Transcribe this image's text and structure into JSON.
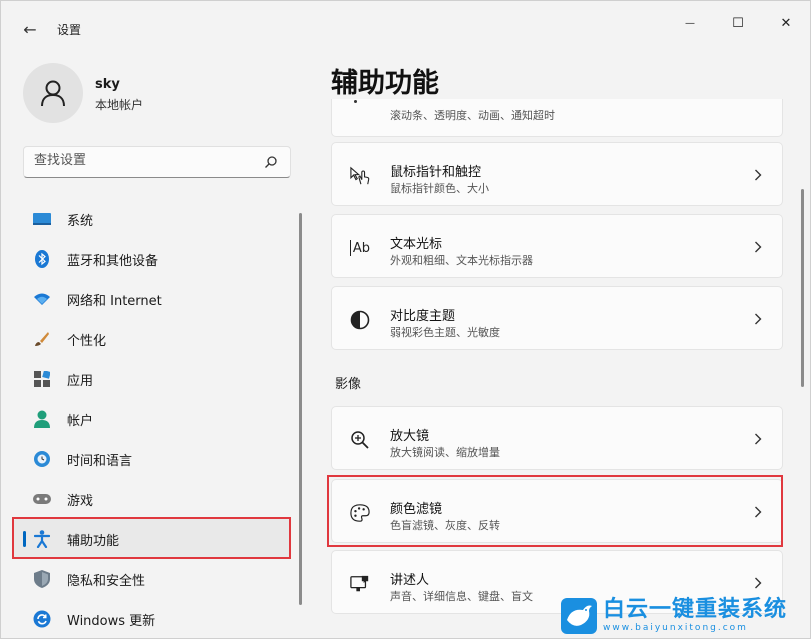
{
  "window": {
    "title": "设置",
    "back_glyph": "←",
    "minimize_glyph": "—",
    "maximize_glyph": "☐",
    "close_glyph": "✕"
  },
  "user": {
    "name": "sky",
    "account_type": "本地帐户"
  },
  "search": {
    "placeholder": "查找设置"
  },
  "nav": {
    "items": [
      {
        "label": "系统",
        "icon": "monitor-icon"
      },
      {
        "label": "蓝牙和其他设备",
        "icon": "bluetooth-icon"
      },
      {
        "label": "网络和 Internet",
        "icon": "wifi-icon"
      },
      {
        "label": "个性化",
        "icon": "brush-icon"
      },
      {
        "label": "应用",
        "icon": "apps-icon"
      },
      {
        "label": "帐户",
        "icon": "account-icon"
      },
      {
        "label": "时间和语言",
        "icon": "globe-clock-icon"
      },
      {
        "label": "游戏",
        "icon": "gamepad-icon"
      },
      {
        "label": "辅助功能",
        "icon": "accessibility-icon",
        "active": true
      },
      {
        "label": "隐私和安全性",
        "icon": "shield-icon"
      },
      {
        "label": "Windows 更新",
        "icon": "update-icon"
      }
    ]
  },
  "main": {
    "title": "辅助功能",
    "partial_card_subtitle": "滚动条、透明度、动画、通知超时",
    "cards": [
      {
        "title": "鼠标指针和触控",
        "subtitle": "鼠标指针颜色、大小",
        "icon": "pointer-touch-icon"
      },
      {
        "title": "文本光标",
        "subtitle": "外观和粗细、文本光标指示器",
        "icon": "text-cursor-icon",
        "icon_text": "Ab"
      },
      {
        "title": "对比度主题",
        "subtitle": "弱视彩色主题、光敏度",
        "icon": "contrast-icon"
      }
    ],
    "section_vision": "影像",
    "vision_cards": [
      {
        "title": "放大镜",
        "subtitle": "放大镜阅读、缩放增量",
        "icon": "magnifier-icon"
      },
      {
        "title": "颜色滤镜",
        "subtitle": "色盲滤镜、灰度、反转",
        "icon": "palette-icon"
      },
      {
        "title": "讲述人",
        "subtitle": "声音、详细信息、键盘、盲文",
        "icon": "narrator-icon"
      }
    ]
  },
  "watermark": {
    "main": "白云一键重装系统",
    "sub": "www.baiyunxitong.com"
  },
  "colors": {
    "accent": "#0067c0",
    "highlight": "#e0383e",
    "watermark": "#1a8fe0"
  }
}
